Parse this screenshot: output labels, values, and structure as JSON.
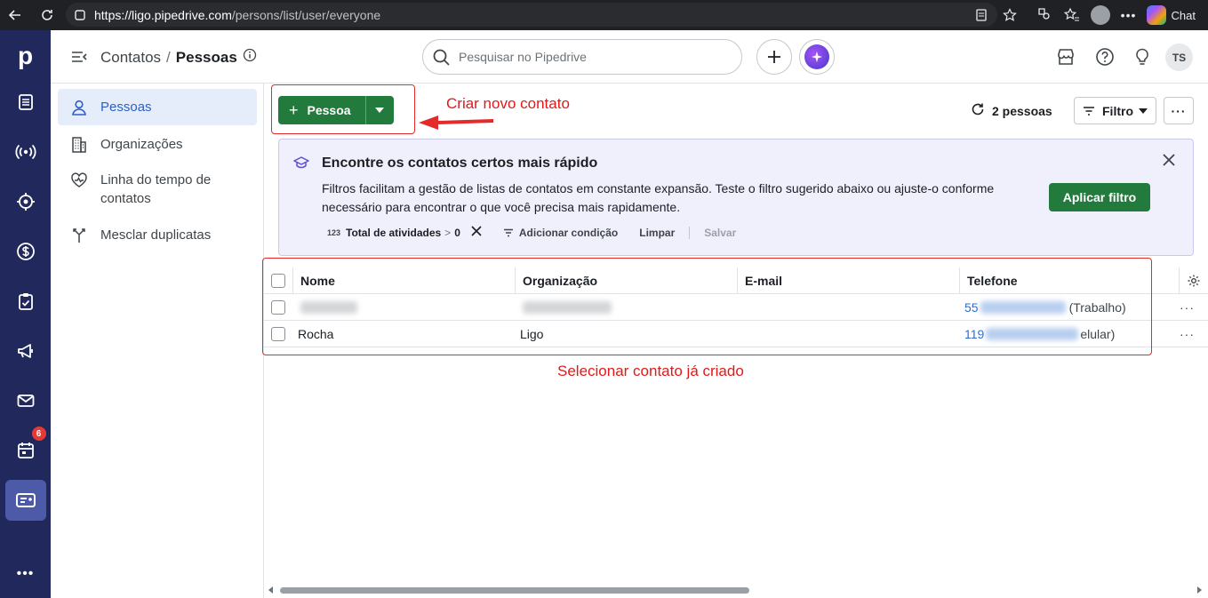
{
  "browser": {
    "url_host": "https://ligo.pipedrive.com",
    "url_path": "/persons/list/user/everyone",
    "chat_label": "Chat"
  },
  "rail": {
    "logo": "p",
    "badge": "6"
  },
  "header": {
    "crumb_parent": "Contatos",
    "crumb_sep": "/",
    "crumb_current": "Pessoas",
    "search_placeholder": "Pesquisar no Pipedrive",
    "avatar_initials": "TS"
  },
  "sidebar": {
    "items": [
      {
        "label": "Pessoas"
      },
      {
        "label": "Organizações"
      },
      {
        "label": "Linha do tempo de contatos"
      },
      {
        "label": "Mesclar duplicatas"
      }
    ]
  },
  "toolbar": {
    "add_label": "Pessoa",
    "count": "2 pessoas",
    "filter_label": "Filtro"
  },
  "annotations": {
    "create": "Criar novo contato",
    "select": "Selecionar contato já criado"
  },
  "banner": {
    "title": "Encontre os contatos certos mais rápido",
    "text": "Filtros facilitam a gestão de listas de contatos em constante expansão. Teste o filtro sugerido abaixo ou ajuste-o conforme necessário para encontrar o que você precisa mais rapidamente.",
    "apply_label": "Aplicar filtro",
    "chip_icon": "123",
    "condition": "Total de atividades",
    "operator": ">",
    "value": "0",
    "add_condition": "Adicionar condição",
    "clear": "Limpar",
    "save": "Salvar"
  },
  "table": {
    "columns": [
      "Nome",
      "Organização",
      "E-mail",
      "Telefone"
    ],
    "rows": [
      {
        "name": "",
        "org": "",
        "email": "",
        "phone_prefix": "55",
        "phone_suffix": "(Trabalho)"
      },
      {
        "name": "Rocha",
        "org": "Ligo",
        "email": "",
        "phone_prefix": "119",
        "phone_suffix": "elular)"
      }
    ]
  },
  "colors": {
    "rail_bg": "#21285c",
    "primary_green": "#237a3d",
    "annotation_red": "#e11919",
    "link_blue": "#2d6cd3"
  }
}
